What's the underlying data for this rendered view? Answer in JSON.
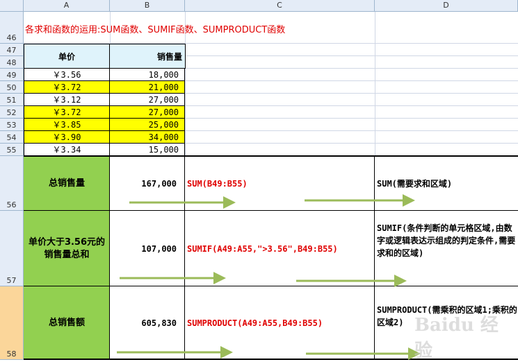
{
  "columns": [
    "A",
    "B",
    "C",
    "D"
  ],
  "rows": [
    "46",
    "47",
    "48",
    "49",
    "50",
    "51",
    "52",
    "53",
    "54",
    "55",
    "56",
    "57",
    "58"
  ],
  "title": "各求和函数的运用:SUM函数、SUMIF函数、SUMPRODUCT函数",
  "table": {
    "header_price": "单价",
    "header_sales": "销售量",
    "data": [
      {
        "price": "￥3.56",
        "sales": "18,000",
        "highlight": false
      },
      {
        "price": "￥3.72",
        "sales": "21,000",
        "highlight": true
      },
      {
        "price": "￥3.12",
        "sales": "27,000",
        "highlight": false
      },
      {
        "price": "￥3.72",
        "sales": "27,000",
        "highlight": true
      },
      {
        "price": "￥3.85",
        "sales": "25,000",
        "highlight": true
      },
      {
        "price": "￥3.90",
        "sales": "34,000",
        "highlight": true
      },
      {
        "price": "￥3.34",
        "sales": "15,000",
        "highlight": false
      }
    ]
  },
  "examples": [
    {
      "label": "总销售量",
      "value": "167,000",
      "formula": "SUM(B49:B55)",
      "description": "SUM(需要求和区域)"
    },
    {
      "label": "单价大于3.56元的销售量总和",
      "value": "107,000",
      "formula": "SUMIF(A49:A55,\">3.56\",B49:B55)",
      "description": "SUMIF(条件判断的单元格区域,由数字或逻辑表达示组成的判定条件,需要求和的区域)"
    },
    {
      "label": "总销售额",
      "value": "605,830",
      "formula": "SUMPRODUCT(A49:A55,B49:B55)",
      "description": "SUMPRODUCT(需乘积的区域1;乘积的区域2)"
    }
  ],
  "watermark": "Baidu 经验",
  "colors": {
    "highlight": "#ffff00",
    "label_bg": "#92d050",
    "header_bg": "#dff3fb",
    "formula": "#e00000",
    "arrow": "#9bbb59",
    "selected_row": "#fbd69a"
  }
}
